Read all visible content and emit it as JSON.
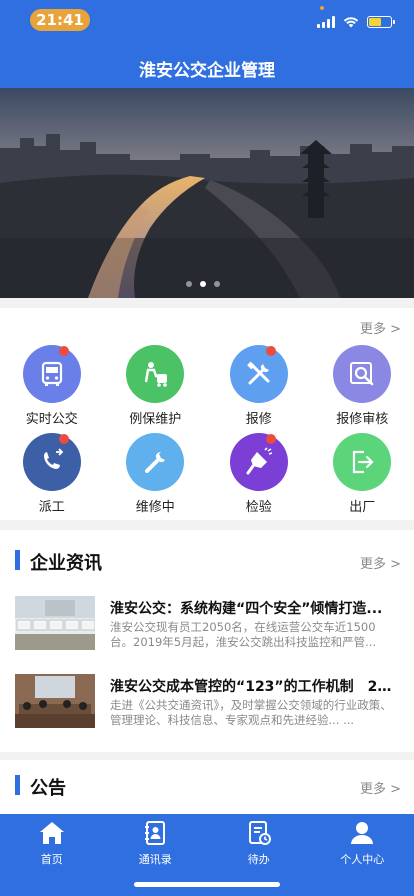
{
  "status_bar": {
    "time": "21:41"
  },
  "app": {
    "title": "淮安公交企业管理"
  },
  "colors": {
    "primary": "#2f6fe0",
    "badge": "#ee4b3f",
    "time_pill": "#e9a33b"
  },
  "banner": {
    "pages": 3,
    "active_page": 2
  },
  "menu": {
    "more_label": "更多 >",
    "items": [
      {
        "label": "实时公交",
        "icon": "bus-icon",
        "color": "#6b7fe8",
        "badge": true
      },
      {
        "label": "例保维护",
        "icon": "maintenance-icon",
        "color": "#4cc266",
        "badge": false
      },
      {
        "label": "报修",
        "icon": "tools-icon",
        "color": "#5f9ff0",
        "badge": true
      },
      {
        "label": "报修审核",
        "icon": "search-icon",
        "color": "#8a88e3",
        "badge": false
      },
      {
        "label": "派工",
        "icon": "dispatch-icon",
        "color": "#3c5fa6",
        "badge": true
      },
      {
        "label": "维修中",
        "icon": "wrench-icon",
        "color": "#5fb0ec",
        "badge": false
      },
      {
        "label": "检验",
        "icon": "flashlight-icon",
        "color": "#7b3fd6",
        "badge": true
      },
      {
        "label": "出厂",
        "icon": "exit-icon",
        "color": "#5bd47a",
        "badge": false
      }
    ]
  },
  "news": {
    "title": "企业资讯",
    "more_label": "更多 >",
    "items": [
      {
        "title": "淮安公交：系统构建“四个安全”倾情打造...",
        "body": "淮安公交现有员工2050名，在线运营公交车近1500台。2019年5月起，淮安公交跳出科技监控和严管..."
      },
      {
        "title": "淮安公交成本管控的“123”的工作机制　202...",
        "body": "走进《公共交通资讯》，及时掌握公交领域的行业政策、管理理论、科技信息、专家观点和先进经验... ..."
      }
    ]
  },
  "notice": {
    "title": "公告",
    "more_label": "更多 >"
  },
  "tabbar": {
    "items": [
      {
        "label": "首页",
        "icon": "home-icon"
      },
      {
        "label": "通讯录",
        "icon": "contacts-icon"
      },
      {
        "label": "待办",
        "icon": "todo-icon"
      },
      {
        "label": "个人中心",
        "icon": "user-icon"
      }
    ]
  }
}
